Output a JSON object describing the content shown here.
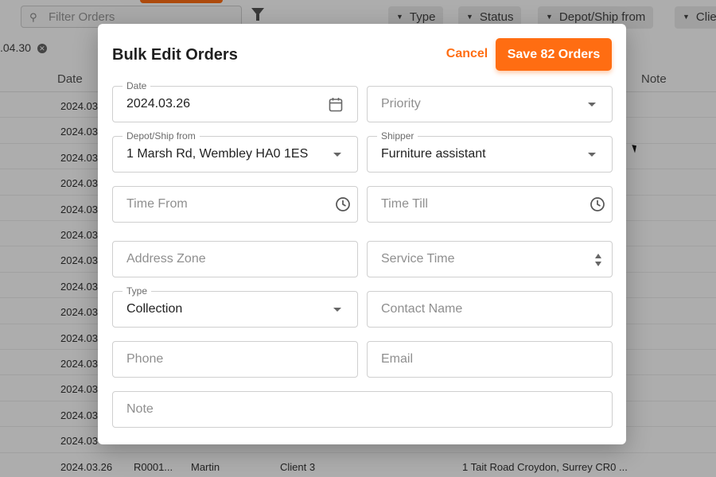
{
  "background": {
    "search_placeholder": "Filter Orders",
    "filter_chips": [
      {
        "label": "Type"
      },
      {
        "label": "Status"
      },
      {
        "label": "Depot/Ship from"
      },
      {
        "label": "Clie"
      }
    ],
    "active_filter": ".04.30",
    "columns": {
      "date": "Date",
      "note": "Note"
    },
    "rows": [
      {
        "date": "2024.03"
      },
      {
        "date": "2024.03"
      },
      {
        "date": "2024.03"
      },
      {
        "date": "2024.03"
      },
      {
        "date": "2024.03"
      },
      {
        "date": "2024.03"
      },
      {
        "date": "2024.03"
      },
      {
        "date": "2024.03"
      },
      {
        "date": "2024.03"
      },
      {
        "date": "2024.03"
      },
      {
        "date": "2024.03"
      },
      {
        "date": "2024.03"
      },
      {
        "date": "2024.03"
      },
      {
        "date": "2024.03"
      }
    ],
    "last_row": {
      "date": "2024.03.26",
      "id": "R0001...",
      "name": "Martin",
      "client": "Client 3",
      "address": "1 Tait Road Croydon, Surrey CR0 ..."
    }
  },
  "modal": {
    "title": "Bulk Edit Orders",
    "cancel_label": "Cancel",
    "save_label": "Save 82 Orders",
    "fields": {
      "date": {
        "label": "Date",
        "value": "2024.03.26"
      },
      "priority": {
        "placeholder": "Priority"
      },
      "depot": {
        "label": "Depot/Ship from",
        "value": "1 Marsh Rd, Wembley HA0 1ES"
      },
      "shipper": {
        "label": "Shipper",
        "value": "Furniture assistant"
      },
      "time_from": {
        "placeholder": "Time From"
      },
      "time_till": {
        "placeholder": "Time Till"
      },
      "address_zone": {
        "placeholder": "Address Zone"
      },
      "service_time": {
        "placeholder": "Service Time"
      },
      "type": {
        "label": "Type",
        "value": "Collection"
      },
      "contact_name": {
        "placeholder": "Contact Name"
      },
      "phone": {
        "placeholder": "Phone"
      },
      "email": {
        "placeholder": "Email"
      },
      "note": {
        "placeholder": "Note"
      }
    }
  },
  "colors": {
    "accent": "#ff6d12",
    "overlay": "rgba(0,0,0,0.32)"
  }
}
